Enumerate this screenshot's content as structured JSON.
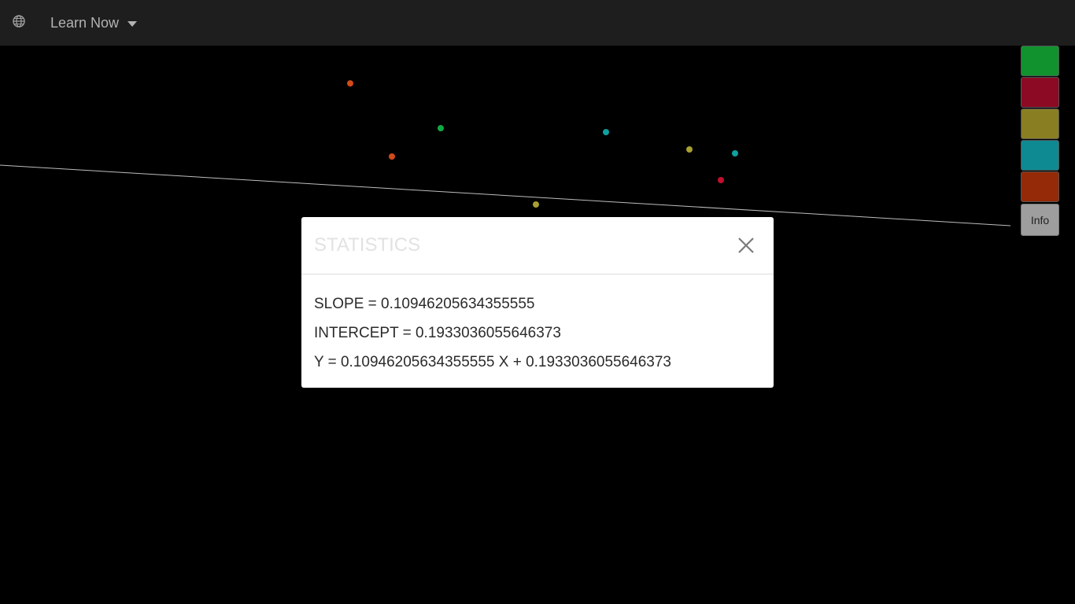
{
  "header": {
    "globe_icon": "globe-icon",
    "brand_label": "Learn Now",
    "dropdown_icon": "caret-down-icon"
  },
  "plot": {
    "background": "#000000",
    "line_color": "#bdbdbd",
    "point_colors": [
      "#d04a1a",
      "#11aa44",
      "#0fa0a0",
      "#a8a030",
      "#c0102e"
    ]
  },
  "palette": {
    "swatches": [
      {
        "name": "green",
        "color": "#11922f"
      },
      {
        "name": "red",
        "color": "#8c0a24"
      },
      {
        "name": "olive",
        "color": "#8a7e22"
      },
      {
        "name": "teal",
        "color": "#0e8a92"
      },
      {
        "name": "orange",
        "color": "#952a08"
      }
    ],
    "info_label": "Info"
  },
  "modal": {
    "title": "STATISTICS",
    "close_icon": "close-icon",
    "slope_line": "SLOPE = 0.10946205634355555",
    "intercept_line": "INTERCEPT = 0.1933036055646373",
    "equation_line": "Y = 0.10946205634355555 X + 0.1933036055646373"
  }
}
